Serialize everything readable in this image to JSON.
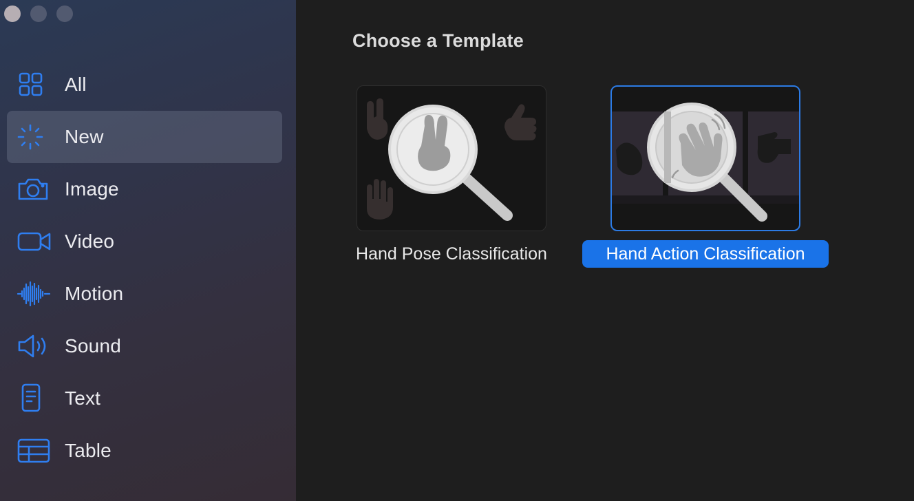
{
  "window": {
    "controls": [
      "close",
      "minimize",
      "zoom"
    ]
  },
  "sidebar": {
    "items": [
      {
        "label": "All",
        "icon": "grid-icon",
        "selected": false
      },
      {
        "label": "New",
        "icon": "sparkle-icon",
        "selected": true
      },
      {
        "label": "Image",
        "icon": "camera-icon",
        "selected": false
      },
      {
        "label": "Video",
        "icon": "video-camera-icon",
        "selected": false
      },
      {
        "label": "Motion",
        "icon": "waveform-icon",
        "selected": false
      },
      {
        "label": "Sound",
        "icon": "speaker-icon",
        "selected": false
      },
      {
        "label": "Text",
        "icon": "document-icon",
        "selected": false
      },
      {
        "label": "Table",
        "icon": "table-icon",
        "selected": false
      }
    ]
  },
  "main": {
    "title": "Choose a Template",
    "templates": [
      {
        "label": "Hand Pose Classification",
        "selected": false
      },
      {
        "label": "Hand Action Classification",
        "selected": true
      }
    ]
  },
  "colors": {
    "accent": "#1a73e8",
    "icon": "#2f7ef0",
    "background": "#1e1e1e"
  }
}
